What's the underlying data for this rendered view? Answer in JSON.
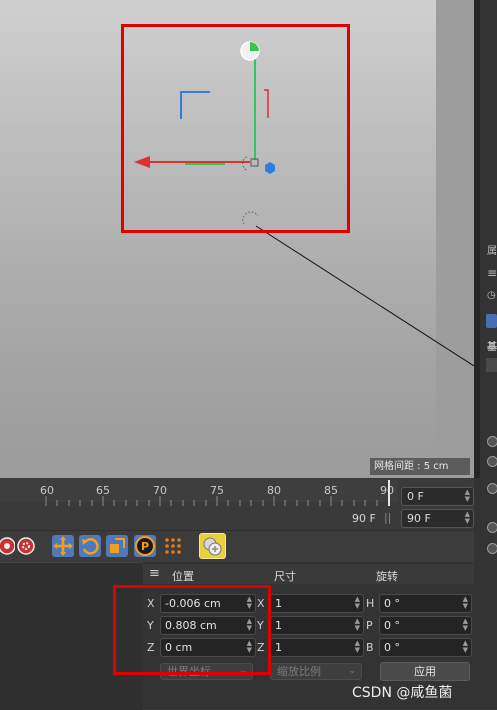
{
  "viewport": {
    "grid_spacing_label": "网格间距 : 5 cm"
  },
  "timeline": {
    "ticks": [
      "60",
      "65",
      "70",
      "75",
      "80",
      "85",
      "90"
    ],
    "end_frame_label": "90 F",
    "separator": "||",
    "current_frame": "0 F",
    "max_frame": "90 F"
  },
  "toolbar": {
    "icons": [
      "record-icon",
      "autokey-icon",
      "move-icon",
      "rotate-icon",
      "scale-icon",
      "param-icon",
      "point-grid-icon",
      "motion-clip-icon"
    ]
  },
  "coord_manager": {
    "headers": {
      "position": "位置",
      "size": "尺寸",
      "rotation": "旋转"
    },
    "rows": [
      {
        "pos_axis": "X",
        "pos_value": "-0.006 cm",
        "size_axis": "X",
        "size_value": "1",
        "rot_axis": "H",
        "rot_value": "0 °"
      },
      {
        "pos_axis": "Y",
        "pos_value": "0.808 cm",
        "size_axis": "Y",
        "size_value": "1",
        "rot_axis": "P",
        "rot_value": "0 °"
      },
      {
        "pos_axis": "Z",
        "pos_value": "0 cm",
        "size_axis": "Z",
        "size_value": "1",
        "rot_axis": "B",
        "rot_value": "0 °"
      }
    ],
    "coord_mode": "世界坐标",
    "size_mode": "缩放比例",
    "apply_label": "应用"
  },
  "right_panel": {
    "glyphs": [
      "属",
      "基"
    ]
  },
  "watermark": "CSDN @咸鱼菌",
  "colors": {
    "annotation_red": "#e00000",
    "axis_x": "#e03030",
    "axis_y": "#30c050",
    "axis_z": "#2f7de0",
    "tool_active": "#4f79b8",
    "tool_yellow": "#e8d040"
  }
}
